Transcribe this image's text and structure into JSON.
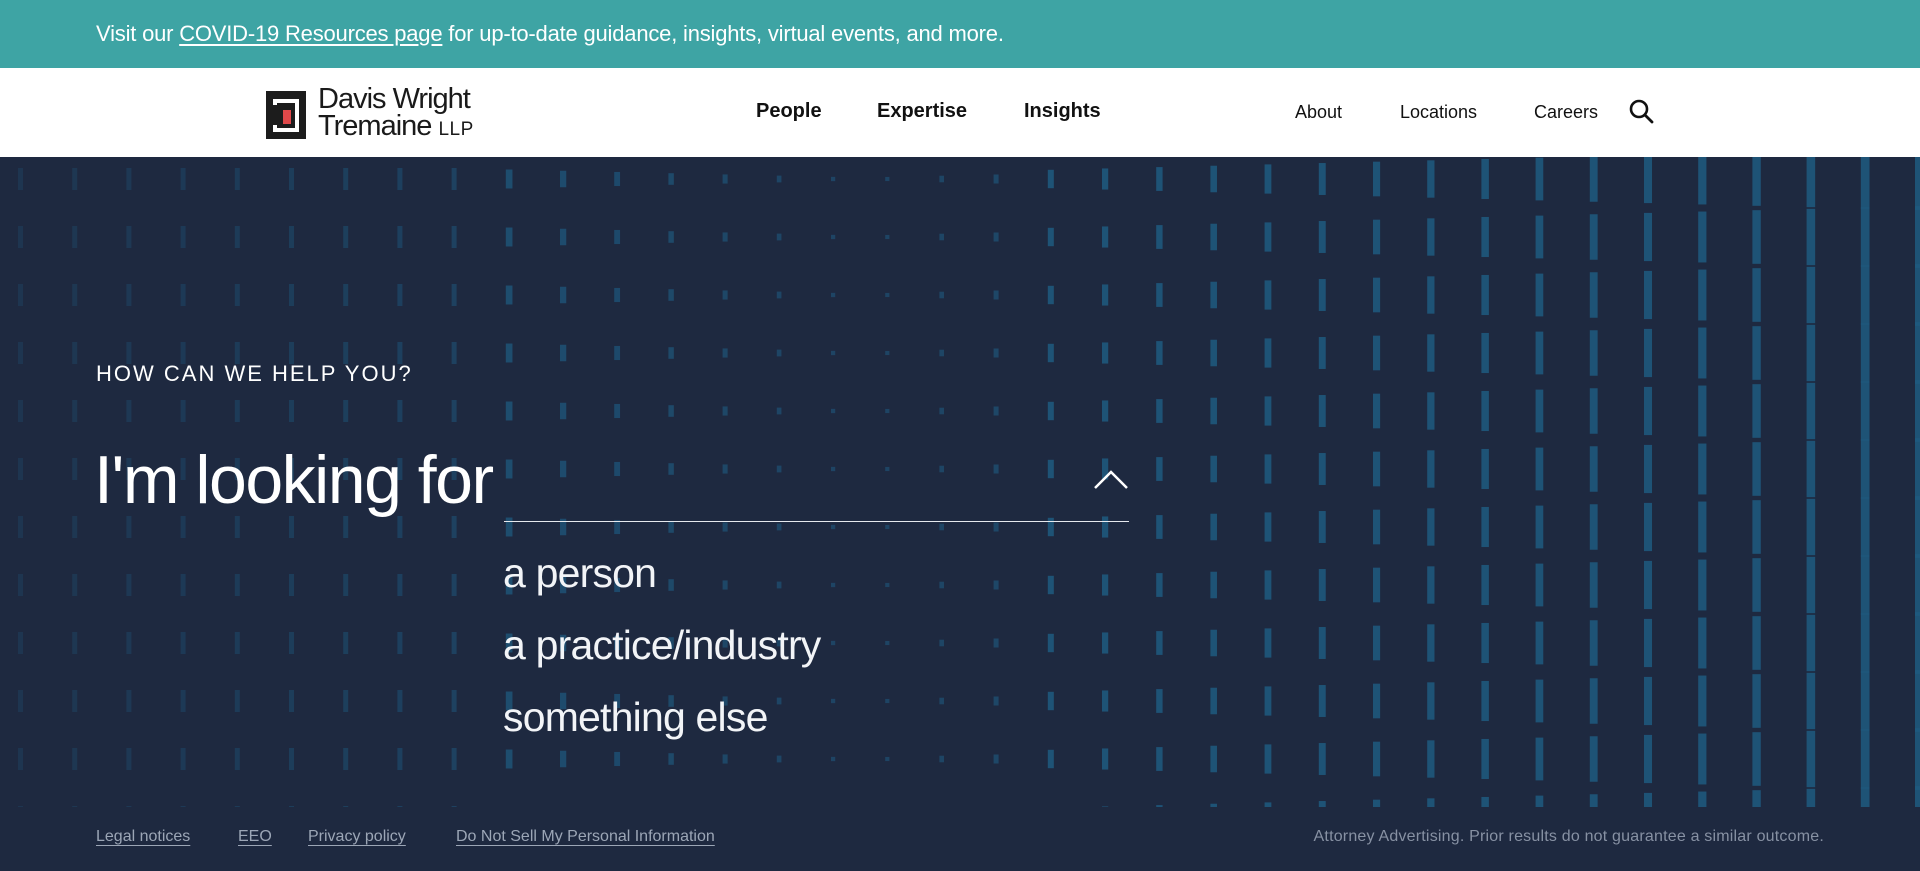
{
  "announcement": {
    "prefix": "Visit our ",
    "link": "COVID-19 Resources page",
    "suffix": " for up-to-date guidance, insights, virtual events, and more."
  },
  "logo": {
    "line1": "Davis Wright",
    "line2": "Tremaine",
    "llp": "LLP"
  },
  "main_nav": [
    {
      "label": "People"
    },
    {
      "label": "Expertise"
    },
    {
      "label": "Insights"
    }
  ],
  "util_nav": [
    {
      "label": "About"
    },
    {
      "label": "Locations"
    },
    {
      "label": "Careers"
    }
  ],
  "hero": {
    "eyebrow": "HOW CAN WE HELP YOU?",
    "lead": "I'm looking for",
    "select_value": "",
    "options": [
      "a person",
      "a practice/industry",
      "something else"
    ]
  },
  "footer": {
    "links": [
      "Legal notices",
      "EEO",
      "Privacy policy",
      "Do Not Sell My Personal Information"
    ],
    "disclaimer": "Attorney Advertising. Prior results do not guarantee a similar outcome."
  },
  "colors": {
    "announcement_bg": "#3ea4a4",
    "hero_bg": "#1e2940",
    "pattern": "#1e5a80",
    "logo_red": "#e0484a"
  }
}
